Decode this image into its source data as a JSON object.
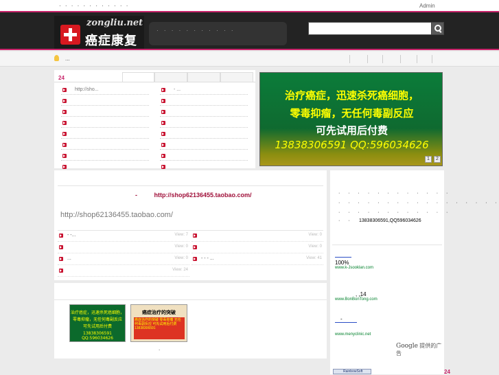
{
  "topbar": {
    "dots": "· · · · · · · · · · · ·",
    "admin": "Admin"
  },
  "header": {
    "logo_url": "zongliu.net",
    "logo_cn": "癌症康复",
    "nav_dots": "· · · · · · · · · · ·",
    "search_placeholder": ""
  },
  "subbar": {
    "text": "..."
  },
  "news": {
    "count": "24",
    "rows_left": [
      "http://sho...",
      "",
      "",
      "",
      "",
      "",
      "",
      ""
    ],
    "rows_right": [
      "- ...",
      "",
      "",
      "",
      "",
      "",
      "",
      ""
    ]
  },
  "banner": {
    "line1": "治疗癌症，迅速杀死癌细胞，",
    "line2": "零毒抑瘤，无任何毒副反应",
    "line3": "可先试用后付费",
    "line4": "13838306591  QQ:596034626",
    "page1": "1",
    "page2": "2"
  },
  "main": {
    "title_prefix": "-",
    "title_link": "http://shop62136455.taobao.com/",
    "subtitle": "http://shop62136455.taobao.com/",
    "rows": [
      {
        "title": "-  -...",
        "views": "View: 7"
      },
      {
        "title": "",
        "views": "View: 0"
      },
      {
        "title": "...",
        "views": "View: 0"
      },
      {
        "title": "",
        "views": "View: 24"
      },
      {
        "title": "",
        "views": "View: 0"
      },
      {
        "title": "",
        "views": "View: 0"
      },
      {
        "title": "-  -  -  ...",
        "views": "View: 41"
      }
    ]
  },
  "images": {
    "thumb1": [
      "治疗癌症，迅速杀死癌细胞，",
      "零毒抑瘤，无任何毒副反应",
      "可先试用后付费",
      "13838306591 QQ:596034626"
    ],
    "thumb2_head": "癌症治疗的突破",
    "thumb2_body": "癌症治疗的突破 零毒抑瘤 无任何毒副反应 可先试用后付费 13838306591",
    "dot": "."
  },
  "sidebar": {
    "lines": [
      "· · · ·  · · · · · ·      ·   ·",
      "· · · · ·  · · · · · · · · · · · · ·",
      "·          · · · · ·  · · · · · ·",
      "·   ·"
    ],
    "phone": "13838306591,QQ596034626",
    "ads": [
      {
        "body": "100%",
        "link": "www.k-Jsooklan.com"
      },
      {
        "body": ",   ,14",
        "link": "www.BonBonTong.com"
      },
      {
        "body": "-",
        "link": "www.menyclinic.net"
      }
    ],
    "google_brand": "Google",
    "google_text": "提供的广告",
    "rb": "RainbowSoft",
    "count": "24"
  }
}
